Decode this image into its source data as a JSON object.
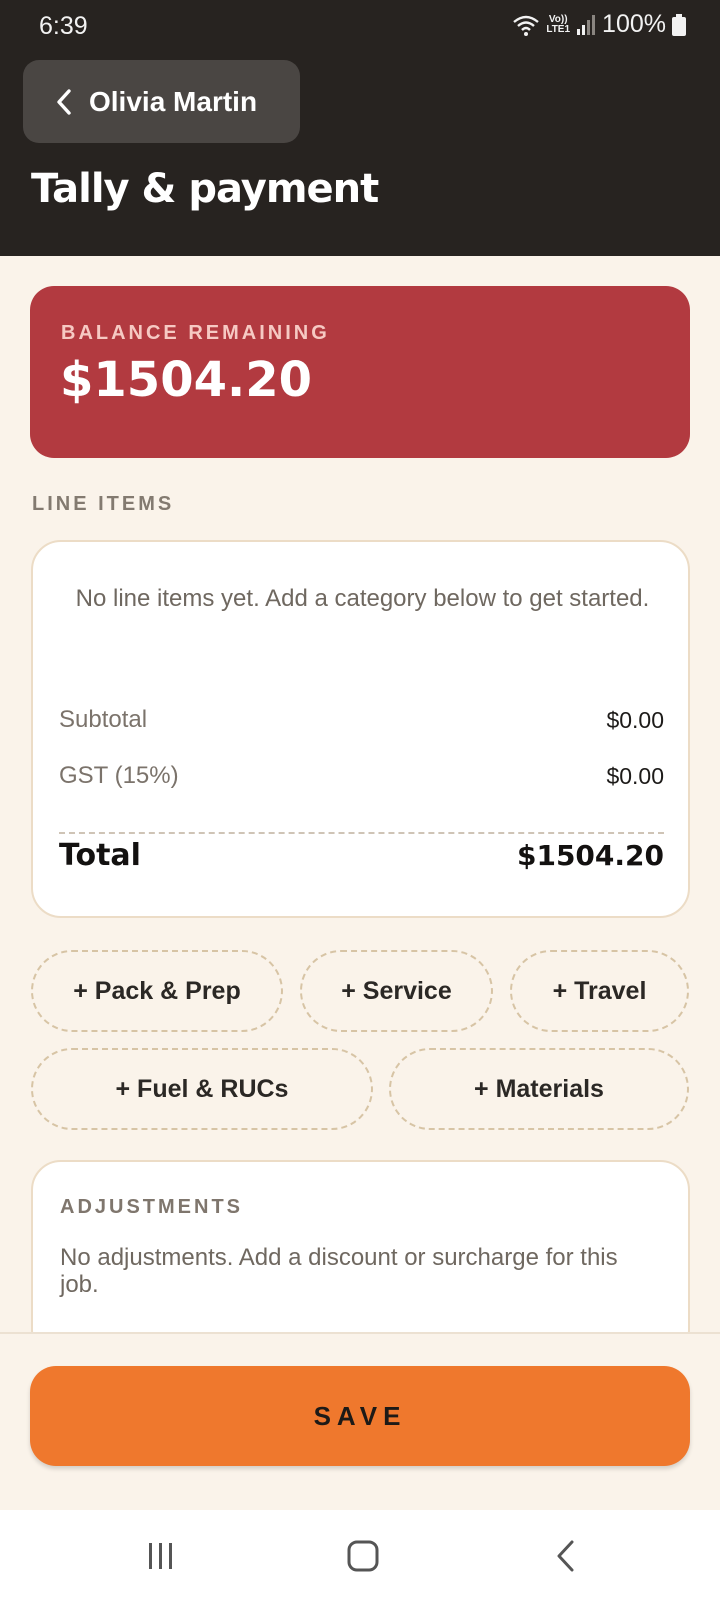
{
  "status_bar": {
    "time": "6:39",
    "battery": "100%",
    "network_label_top": "Vo))",
    "network_label_bottom": "LTE1",
    "icons": [
      "wifi-icon",
      "lte-icon",
      "signal-icon",
      "battery-icon"
    ]
  },
  "header": {
    "back_label": "Olivia Martin",
    "back_icon": "chevron-left-icon",
    "title": "Tally & payment"
  },
  "balance": {
    "label": "BALANCE REMAINING",
    "value": "$1504.20"
  },
  "line_items": {
    "section_label": "LINE ITEMS",
    "empty_message": "No line items yet. Add a category below to get started.",
    "subtotal_label": "Subtotal",
    "subtotal_value": "$0.00",
    "gst_label": "GST (15%)",
    "gst_value": "$0.00",
    "total_label": "Total",
    "total_value": "$1504.20"
  },
  "categories": [
    {
      "label": "+ Pack & Prep"
    },
    {
      "label": "+ Service"
    },
    {
      "label": "+ Travel"
    },
    {
      "label": "+ Fuel & RUCs"
    },
    {
      "label": "+ Materials"
    }
  ],
  "adjustments": {
    "label": "ADJUSTMENTS",
    "empty_message": "No adjustments. Add a discount or surcharge for this job."
  },
  "save_label": "SAVE",
  "nav": {
    "icons": [
      "recent-apps-icon",
      "home-icon",
      "back-icon"
    ]
  },
  "colors": {
    "header_bg": "#272320",
    "balance_bg": "#b23a40",
    "save_bg": "#ef782d",
    "page_bg": "#faf3ea"
  }
}
